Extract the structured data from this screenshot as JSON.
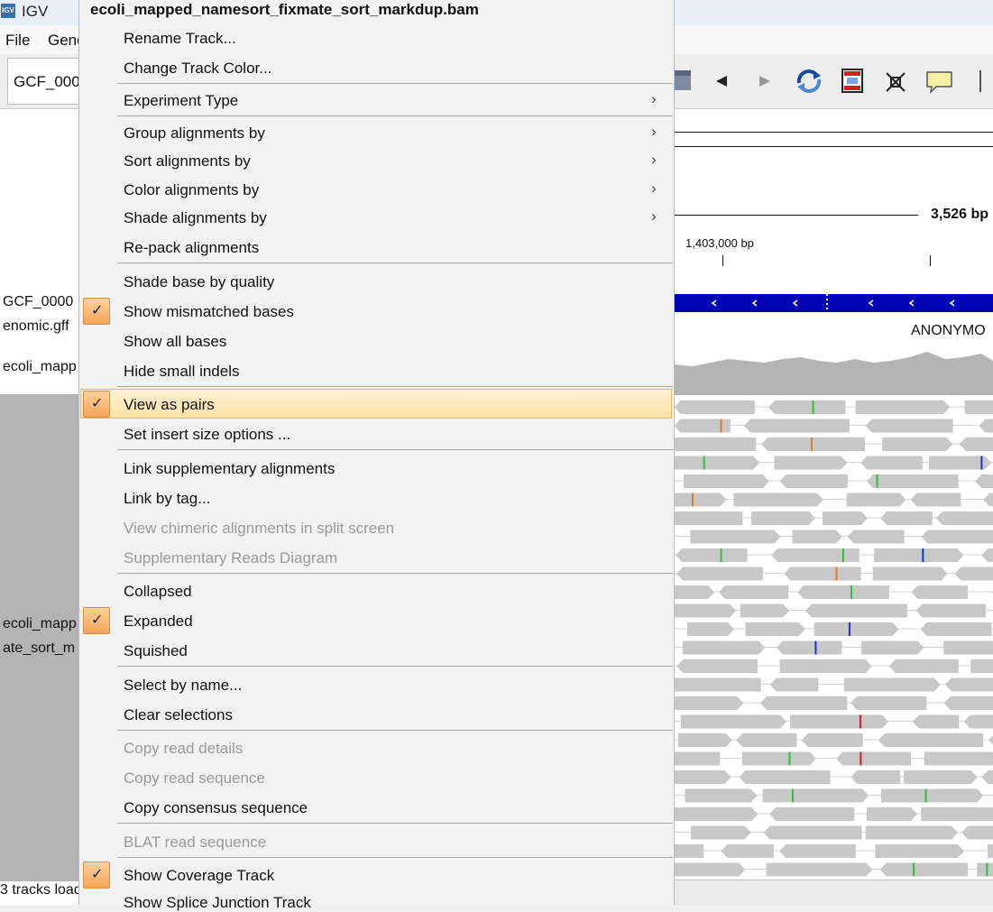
{
  "window": {
    "title": "IGV",
    "icon_text": "IGV"
  },
  "menubar": {
    "items": [
      "File",
      "Genc"
    ]
  },
  "toolbar": {
    "genome": "GCF_000"
  },
  "ruler": {
    "span": "3,526 bp",
    "position": "1,403,000 bp"
  },
  "gene_track": {
    "label": "ANONYMO"
  },
  "left_panel": {
    "tracks": [
      "GCF_0000",
      "enomic.gff",
      "ecoli_mapp",
      "ecoli_mapp",
      "ate_sort_m"
    ],
    "status": "3 tracks load"
  },
  "context_menu": {
    "title": "ecoli_mapped_namesort_fixmate_sort_markdup.bam",
    "items": {
      "rename": "Rename Track...",
      "change_color": "Change Track Color...",
      "experiment_type": "Experiment Type",
      "group_by": "Group alignments by",
      "sort_by": "Sort alignments by",
      "color_by": "Color alignments by",
      "shade_by": "Shade alignments by",
      "repack": "Re-pack alignments",
      "shade_quality": "Shade base by quality",
      "show_mismatched": "Show mismatched bases",
      "show_all_bases": "Show all bases",
      "hide_indels": "Hide small indels",
      "view_pairs": "View as pairs",
      "insert_size": "Set insert size options ...",
      "link_supp": "Link supplementary alignments",
      "link_tag": "Link by tag...",
      "view_chimeric": "View chimeric alignments in split screen",
      "supp_diagram": "Supplementary Reads Diagram",
      "collapsed": "Collapsed",
      "expanded": "Expanded",
      "squished": "Squished",
      "select_name": "Select by name...",
      "clear_sel": "Clear selections",
      "copy_details": "Copy read details",
      "copy_seq": "Copy read sequence",
      "copy_consensus": "Copy consensus sequence",
      "blat": "BLAT read sequence",
      "show_coverage": "Show Coverage Track",
      "show_splice": "Show Splice Junction Track"
    },
    "checked": [
      "show_mismatched",
      "view_pairs",
      "expanded",
      "show_coverage"
    ],
    "submenu_arrow": "›"
  },
  "icons": [
    "back-arrow-icon",
    "forward-arrow-icon",
    "refresh-icon",
    "region-icon",
    "resize-icon",
    "speech-bubble-icon"
  ],
  "colors": {
    "gene_blue": "#0000b4",
    "read_gray": "#c8c8c8",
    "coverage_gray": "#b4b4b4",
    "menu_highlight": "#fde3a8",
    "check_orange": "#f5a45a"
  }
}
